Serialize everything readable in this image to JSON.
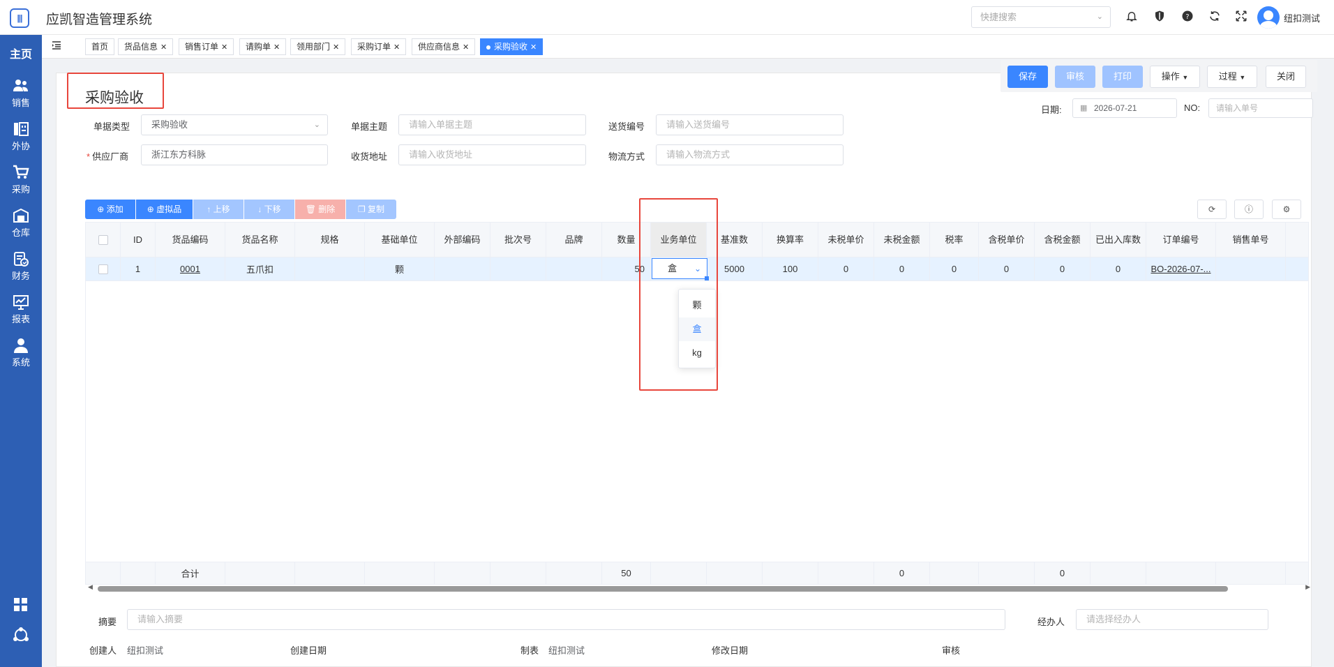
{
  "header": {
    "logo_text": "|||",
    "app_title": "应凯智造管理系统",
    "quick_search_placeholder": "快捷搜索",
    "user_name": "纽扣测试"
  },
  "sidebar": {
    "home": "主页",
    "items": [
      {
        "label": "销售",
        "icon": "users-icon"
      },
      {
        "label": "外协",
        "icon": "factory-icon"
      },
      {
        "label": "采购",
        "icon": "cart-icon"
      },
      {
        "label": "仓库",
        "icon": "warehouse-icon"
      },
      {
        "label": "财务",
        "icon": "finance-icon"
      },
      {
        "label": "报表",
        "icon": "chart-icon"
      },
      {
        "label": "系统",
        "icon": "person-icon"
      }
    ]
  },
  "tabs": [
    {
      "label": "首页",
      "closable": false
    },
    {
      "label": "货品信息",
      "closable": true
    },
    {
      "label": "销售订单",
      "closable": true
    },
    {
      "label": "请购单",
      "closable": true
    },
    {
      "label": "领用部门",
      "closable": true
    },
    {
      "label": "采购订单",
      "closable": true
    },
    {
      "label": "供应商信息",
      "closable": true
    },
    {
      "label": "采购验收",
      "closable": true,
      "active": true
    }
  ],
  "actions": {
    "save": "保存",
    "audit": "审核",
    "print": "打印",
    "operate": "操作",
    "process": "过程",
    "close": "关闭"
  },
  "page_title": "采购验收",
  "date": {
    "label": "日期:",
    "value": "2026-07-21"
  },
  "no": {
    "label": "NO:",
    "placeholder": "请输入单号"
  },
  "form": {
    "doc_type": {
      "label": "单据类型",
      "value": "采购验收"
    },
    "doc_subject": {
      "label": "单据主题",
      "placeholder": "请输入单据主题"
    },
    "delivery_no": {
      "label": "送货编号",
      "placeholder": "请输入送货编号"
    },
    "supplier": {
      "label": "供应厂商",
      "required_mark": "*",
      "value": "浙江东方科脉"
    },
    "receive_address": {
      "label": "收货地址",
      "placeholder": "请输入收货地址"
    },
    "logistics": {
      "label": "物流方式",
      "placeholder": "请输入物流方式"
    }
  },
  "toolbar": {
    "add": "添加",
    "virtual": "虚拟品",
    "move_up": "上移",
    "move_down": "下移",
    "delete": "删除",
    "copy": "复制"
  },
  "table": {
    "columns": [
      "ID",
      "货品编码",
      "货品名称",
      "规格",
      "基础单位",
      "外部编码",
      "批次号",
      "品牌",
      "数量",
      "业务单位",
      "基准数",
      "换算率",
      "未税单价",
      "未税金额",
      "税率",
      "含税单价",
      "含税金额",
      "已出入库数",
      "订单编号",
      "销售单号"
    ],
    "rows": [
      {
        "id": "1",
        "code": "0001",
        "name": "五爪扣",
        "spec": "",
        "base_unit": "颗",
        "ext_code": "",
        "batch": "",
        "brand": "",
        "qty": "50",
        "biz_unit": "盒",
        "base_qty": "5000",
        "rate": "100",
        "price_notax": "0",
        "amount_notax": "0",
        "tax": "0",
        "price_tax": "0",
        "amount_tax": "0",
        "io_qty": "0",
        "order_no": "BO-2026-07-...",
        "sales_no": ""
      }
    ],
    "footer": {
      "label": "合计",
      "qty": "50",
      "amount_notax": "0",
      "amount_tax": "0"
    }
  },
  "unit_dropdown": [
    "颗",
    "盒",
    "kg"
  ],
  "unit_selected": "盒",
  "bottom": {
    "remark": {
      "label": "摘要",
      "placeholder": "请输入摘要"
    },
    "handler": {
      "label": "经办人",
      "placeholder": "请选择经办人"
    },
    "creator": {
      "label": "创建人",
      "value": "纽扣测试"
    },
    "create_date": {
      "label": "创建日期",
      "value": ""
    },
    "maker": {
      "label": "制表",
      "value": "纽扣测试"
    },
    "modify_date": {
      "label": "修改日期",
      "value": ""
    },
    "auditor": {
      "label": "审核",
      "value": ""
    }
  },
  "colors": {
    "primary": "#3a86ff",
    "sidebar": "#2d5fb4",
    "highlight": "#e8463c"
  }
}
